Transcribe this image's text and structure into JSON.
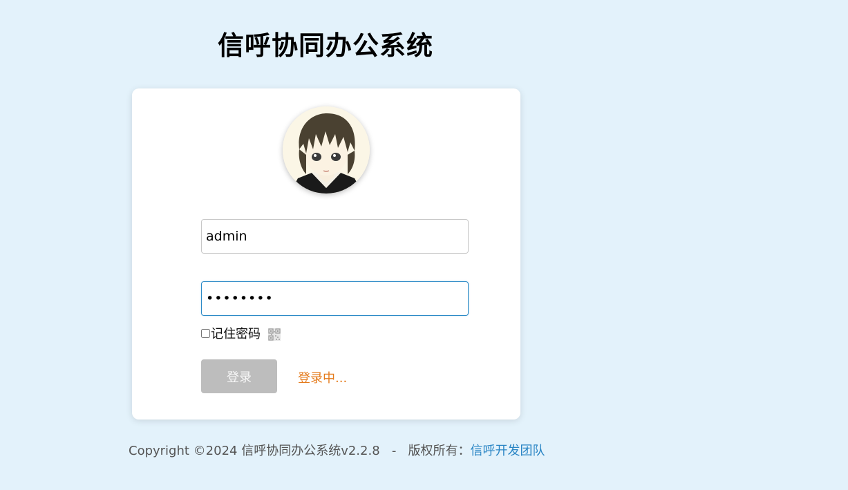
{
  "header": {
    "title": "信呼协同办公系统"
  },
  "login_form": {
    "avatar_icon": "avatar-icon",
    "username": {
      "value": "admin",
      "placeholder": ""
    },
    "password": {
      "value": "12345678",
      "placeholder": ""
    },
    "remember_label": "记住密码",
    "remember_checked": false,
    "qr_icon": "qr-code-icon",
    "login_button_label": "登录",
    "status_text": "登录中..."
  },
  "footer": {
    "copyright": "Copyright ©2024 信呼协同办公系统v2.2.8",
    "separator": "-",
    "rights_label": "版权所有：",
    "team_link": "信呼开发团队"
  },
  "colors": {
    "background": "#e3f2fb",
    "card": "#ffffff",
    "button_disabled": "#bdbdbd",
    "status_orange": "#e47b1c",
    "link_blue": "#2b86c5",
    "focus_border": "#2c8ac7"
  }
}
